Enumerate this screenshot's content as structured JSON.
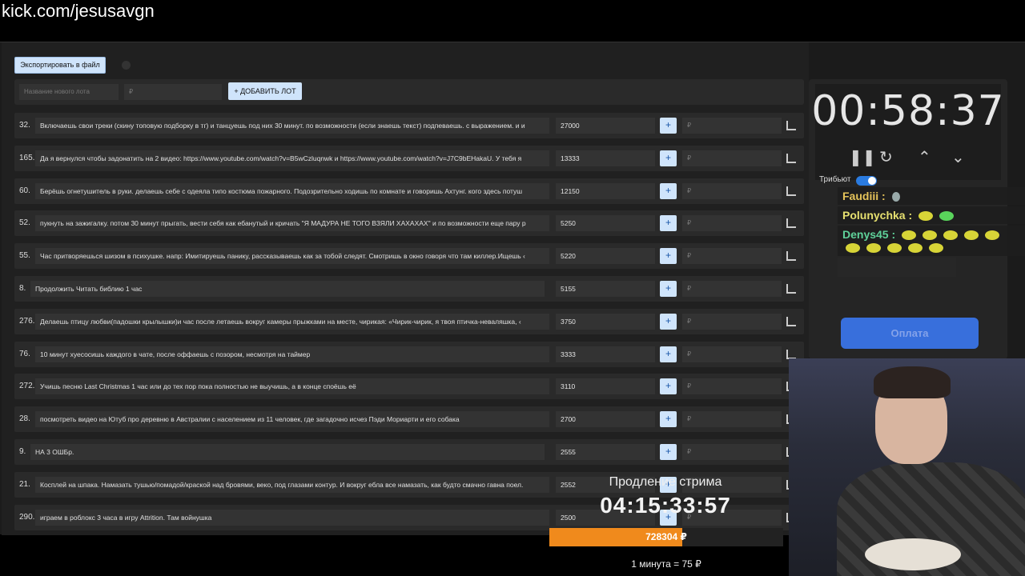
{
  "url": "kick.com/jesusavgn",
  "toolbar": {
    "export_label": "Экспортировать в файл"
  },
  "new_lot": {
    "name_placeholder": "Название нового лота",
    "amount_placeholder": "₽",
    "add_label": "+ ДОБАВИТЬ ЛОТ"
  },
  "lots": [
    {
      "num": "32.",
      "title": "Включаешь свои треки (скину топовую подборку в тг) и танцуешь под них 30 минут. по возможности (если знаешь текст) подпеваешь. с выражением. и и",
      "amount": "27000",
      "plus": "+",
      "rub": "₽"
    },
    {
      "num": "165.",
      "title": "Да я вернулся чтобы задонатить на 2 видео: https://www.youtube.com/watch?v=B5wCzluqnwk и https://www.youtube.com/watch?v=J7C9bEHakaU. У тебя я",
      "amount": "13333",
      "plus": "+",
      "rub": "₽"
    },
    {
      "num": "60.",
      "title": "Берёшь огнетушитель в руки. делаешь себе с одеяла типо костюма пожарного. Подозрительно ходишь по комнате и говоришь Ахтунг. кого здесь потуш",
      "amount": "12150",
      "plus": "+",
      "rub": "₽"
    },
    {
      "num": "52.",
      "title": "пукнуть на зажигалку. потом 30 минут прыгать, вести себя как ебанутый и кричать \"Я МАДУРА НЕ ТОГО ВЗЯЛИ ХАХАХАХ\" и по возможности еще пару р",
      "amount": "5250",
      "plus": "+",
      "rub": "₽"
    },
    {
      "num": "55.",
      "title": "Час притворяешься шизом в психушке. напр: Имитируешь панику, рассказываешь как за тобой следят. Смотришь в окно говоря что там киллер.Ищешь ‹",
      "amount": "5220",
      "plus": "+",
      "rub": "₽"
    },
    {
      "num": "8.",
      "title": "Продолжить Читать библию 1 час",
      "amount": "5155",
      "plus": "+",
      "rub": "₽"
    },
    {
      "num": "276.",
      "title": "Делаешь птицу любви(падошки крылышки)и час после летаешь вокруг камеры прыжками на месте, чирикая: «Чирик-чирик, я твоя птичка-неваляшка, ‹",
      "amount": "3750",
      "plus": "+",
      "rub": "₽"
    },
    {
      "num": "76.",
      "title": "10 минут хуесосишь каждого в чате, после оффаешь с позором, несмотря на таймер",
      "amount": "3333",
      "plus": "+",
      "rub": "₽"
    },
    {
      "num": "272.",
      "title": "Учишь песню Last Christmas 1 час или до тех пор пока полностью не выучишь, а в конце споёшь её",
      "amount": "3110",
      "plus": "+",
      "rub": "₽"
    },
    {
      "num": "28.",
      "title": "посмотреть видео на Ютуб про деревню в Австралии с населением из 11 человек, где загадочно исчез Пэди Мориарти и его собака",
      "amount": "2700",
      "plus": "+",
      "rub": "₽"
    },
    {
      "num": "9.",
      "title": "НА 3 ОШБр.",
      "amount": "2555",
      "plus": "+",
      "rub": "₽"
    },
    {
      "num": "21.",
      "title": "Косплей на шпака. Намазать тушью/помадой/краской над бровями, веко, под глазами контур. И вокруг ебла все намазать, как будто смачно гавна поел.",
      "amount": "2552",
      "plus": "+",
      "rub": "₽"
    },
    {
      "num": "290.",
      "title": "играем в роблокс 3 часа в игру Attrition. Там войнушка",
      "amount": "2500",
      "plus": "+",
      "rub": "₽"
    }
  ],
  "timer": {
    "value": "00:58:37"
  },
  "tribute_label": "Трибьют",
  "chat": [
    {
      "user": "Faudiii",
      "sep": " :",
      "color": "#e6c45a"
    },
    {
      "user": "Polunychka",
      "sep": " :",
      "color": "#e6e070"
    },
    {
      "user": "Denys45",
      "sep": " :",
      "color": "#5fd29a"
    }
  ],
  "pay_button": "Оплата",
  "extension": {
    "label": "Продление стрима",
    "time": "04:15:33:57",
    "total": "728304 ₽",
    "progress": 0.57,
    "rate": "1 минута = 75 ₽"
  }
}
